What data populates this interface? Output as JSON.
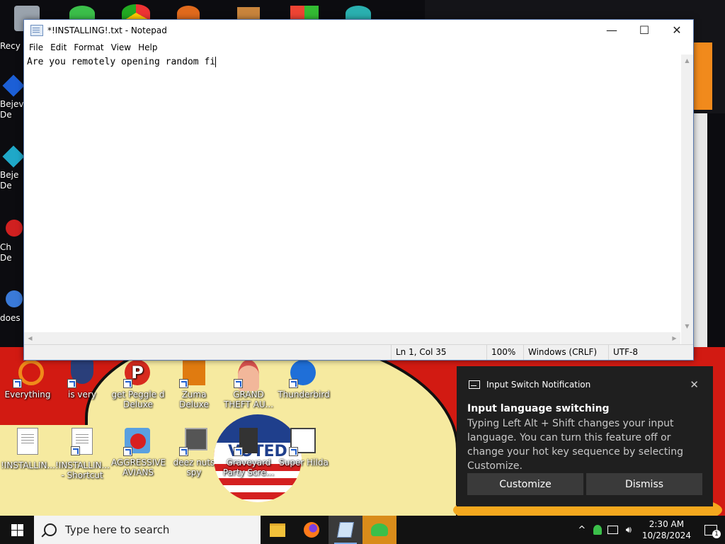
{
  "notepad": {
    "title": "*!INSTALLING!.txt - Notepad",
    "menu": [
      "File",
      "Edit",
      "Format",
      "View",
      "Help"
    ],
    "content": "Are you remotely opening random fi",
    "status": {
      "position": "Ln 1, Col 35",
      "zoom": "100%",
      "line_ending": "Windows (CRLF)",
      "encoding": "UTF-8"
    },
    "window_buttons": {
      "minimize": "—",
      "maximize": "☐",
      "close": "✕"
    }
  },
  "desktop": {
    "partial_left": [
      "Recy",
      "Bejev\nDe",
      "Beje\nDe",
      "Ch\nDe",
      "does"
    ],
    "icons": [
      {
        "label": "Everything"
      },
      {
        "label": "is very"
      },
      {
        "label": "get Peggle d Deluxe"
      },
      {
        "label": "Zuma Deluxe"
      },
      {
        "label": "GRAND THEFT AU..."
      },
      {
        "label": "Thunderbird"
      },
      {
        "label": "!INSTALLIN..."
      },
      {
        "label": "!INSTALLIN... - Shortcut"
      },
      {
        "label": "AGGRESSIVE AVIANS"
      },
      {
        "label": "deez nuts spy"
      },
      {
        "label": "Graveyard Party Scre..."
      },
      {
        "label": "Super Hilda"
      }
    ],
    "sticker_text": "VOTED"
  },
  "toast": {
    "header": "Input Switch Notification",
    "title": "Input language switching",
    "body": "Typing Left Alt + Shift changes your input language. You can turn this feature off or change your hot key sequence by selecting Customize.",
    "customize_label": "Customize",
    "dismiss_label": "Dismiss",
    "close_glyph": "✕"
  },
  "taskbar": {
    "search_placeholder": "Type here to search",
    "time": "2:30 AM",
    "date": "10/28/2024",
    "notification_count": "1",
    "chevron": "^"
  }
}
